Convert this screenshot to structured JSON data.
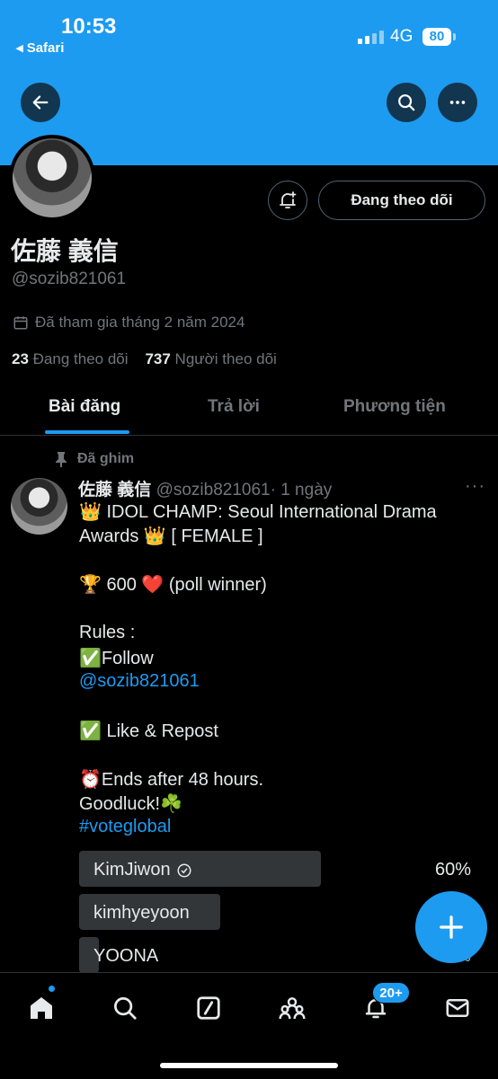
{
  "status_bar": {
    "time": "10:53",
    "back_app": "Safari",
    "network": "4G",
    "battery": "80"
  },
  "profile": {
    "display_name": "佐藤 義信",
    "handle": "@sozib821061",
    "joined": "Đã tham gia tháng 2 năm 2024",
    "following_count": "23",
    "following_label": "Đang theo dõi",
    "followers_count": "737",
    "followers_label": "Người theo dõi",
    "follow_button": "Đang theo dõi"
  },
  "tabs": [
    {
      "label": "Bài đăng",
      "active": true
    },
    {
      "label": "Trả lời",
      "active": false
    },
    {
      "label": "Phương tiện",
      "active": false
    }
  ],
  "tweet": {
    "pinned_label": "Đã ghim",
    "author_name": "佐藤 義信",
    "author_handle": "@sozib821061",
    "time": "· 1 ngày",
    "lines": [
      "👑 IDOL CHAMP: Seoul International Drama",
      "Awards 👑 [ FEMALE ]",
      "🏆 600 ❤️ (poll winner)",
      "Rules :",
      "✅Follow",
      "@sozib821061",
      "✅ Like & Repost",
      "⏰Ends after 48 hours.",
      "Goodluck!☘️",
      "#voteglobal"
    ],
    "poll": [
      {
        "label": "KimJiwon",
        "percent": "60%",
        "value": 60,
        "winner": true
      },
      {
        "label": "kimhyeyoon",
        "percent": "",
        "value": 35,
        "winner": false
      },
      {
        "label": "YOONA",
        "percent": "5%",
        "value": 5,
        "winner": false
      }
    ]
  },
  "notifications_badge": "20+",
  "colors": {
    "accent": "#1d9bf0",
    "background": "#000000",
    "muted": "#71767b"
  }
}
